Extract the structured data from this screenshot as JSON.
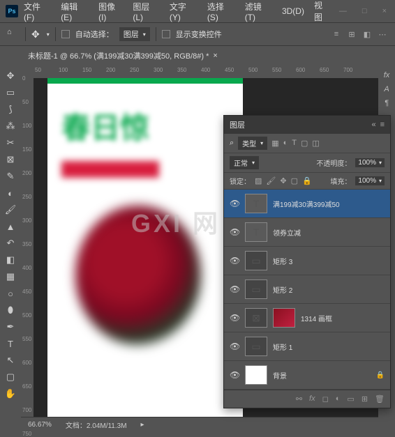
{
  "menu": {
    "file": "文件(F)",
    "edit": "编辑(E)",
    "image": "图像(I)",
    "layer": "图层(L)",
    "text": "文字(Y)",
    "select": "选择(S)",
    "filter": "滤镜(T)",
    "threed": "3D(D)",
    "view": "视图"
  },
  "optbar": {
    "auto_select": "自动选择：",
    "target": "图层",
    "show_transform": "显示变换控件"
  },
  "doc_tab": {
    "title": "未标题-1 @ 66.7% (满199减30满399减50, RGB/8#) *"
  },
  "ruler_h": [
    "50",
    "100",
    "150",
    "200",
    "250",
    "300",
    "350",
    "400",
    "450",
    "500",
    "550",
    "600",
    "650",
    "700"
  ],
  "ruler_v": [
    "0",
    "50",
    "100",
    "150",
    "200",
    "250",
    "300",
    "350",
    "400",
    "450",
    "500",
    "550",
    "600",
    "650",
    "700",
    "750"
  ],
  "canvas": {
    "headline": "春日惊",
    "watermark": "GXI 网"
  },
  "panel": {
    "title": "图层",
    "type_label": "类型",
    "blend": "正常",
    "opacity_label": "不透明度：",
    "opacity_val": "100%",
    "lock_label": "锁定：",
    "fill_label": "填充：",
    "fill_val": "100%"
  },
  "layers": [
    {
      "name": "满199减30满399减50",
      "kind": "T",
      "selected": true
    },
    {
      "name": "领券立减",
      "kind": "T"
    },
    {
      "name": "矩形 3",
      "kind": "shape"
    },
    {
      "name": "矩形 2",
      "kind": "shape"
    },
    {
      "name": "1314 画框",
      "kind": "frame"
    },
    {
      "name": "矩形 1",
      "kind": "shape"
    },
    {
      "name": "背景",
      "kind": "bg",
      "locked": true
    }
  ],
  "status": {
    "zoom": "66.67%",
    "doc": "文档：2.04M/11.3M"
  }
}
